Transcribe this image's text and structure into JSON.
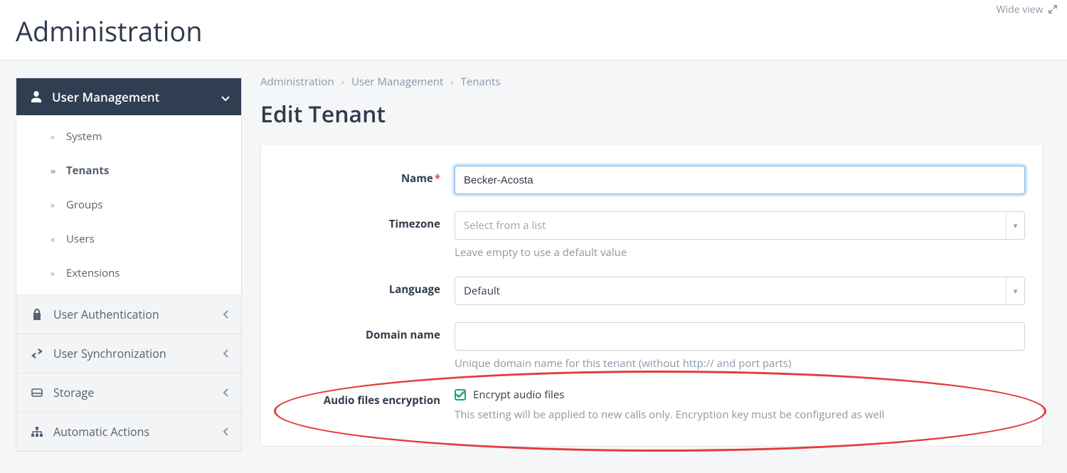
{
  "header": {
    "title": "Administration",
    "wide_view": "Wide view"
  },
  "sidebar": {
    "header": "User Management",
    "items": [
      {
        "label": "System"
      },
      {
        "label": "Tenants"
      },
      {
        "label": "Groups"
      },
      {
        "label": "Users"
      },
      {
        "label": "Extensions"
      }
    ],
    "sections": [
      {
        "label": "User Authentication"
      },
      {
        "label": "User Synchronization"
      },
      {
        "label": "Storage"
      },
      {
        "label": "Automatic Actions"
      }
    ]
  },
  "breadcrumb": {
    "a": "Administration",
    "b": "User Management",
    "c": "Tenants"
  },
  "page": {
    "title": "Edit Tenant"
  },
  "form": {
    "name": {
      "label": "Name",
      "value": "Becker-Acosta"
    },
    "timezone": {
      "label": "Timezone",
      "placeholder": "Select from a list",
      "help": "Leave empty to use a default value"
    },
    "language": {
      "label": "Language",
      "value": "Default"
    },
    "domain": {
      "label": "Domain name",
      "value": "",
      "help": "Unique domain name for this tenant (without http:// and port parts)"
    },
    "encryption": {
      "label": "Audio files encryption",
      "checkbox": "Encrypt audio files",
      "help": "This setting will be applied to new calls only. Encryption key must be configured as well"
    }
  }
}
